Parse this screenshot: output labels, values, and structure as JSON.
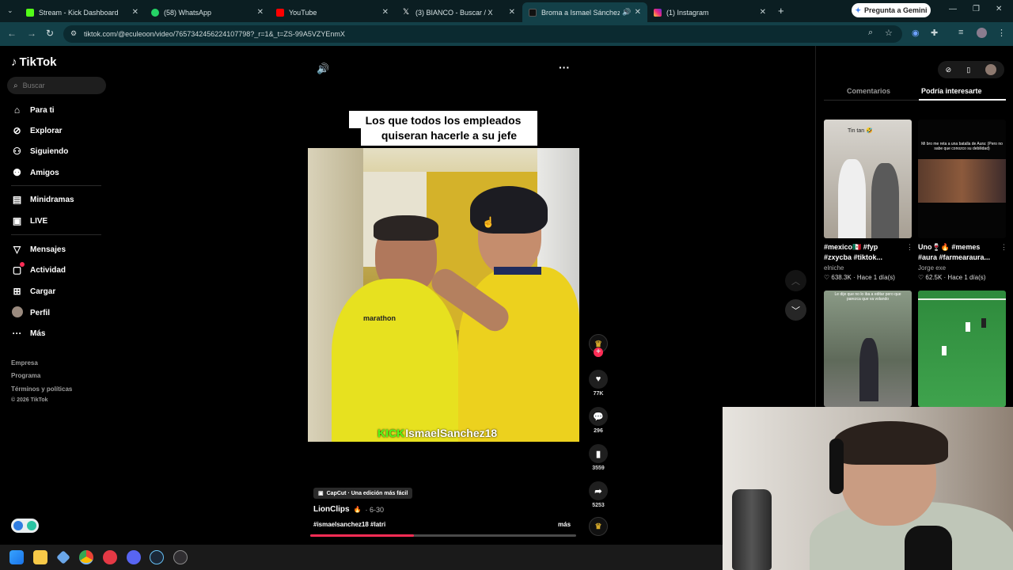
{
  "browser": {
    "tabs": [
      {
        "label": "Stream - Kick Dashboard",
        "color": "#53fc18"
      },
      {
        "label": "(58) WhatsApp",
        "color": "#25d366"
      },
      {
        "label": "YouTube",
        "color": "#ff0000"
      },
      {
        "label": "(3) BIANCO - Buscar / X",
        "color": "#ffffff"
      },
      {
        "label": "Broma a Ismael Sánchez po",
        "color": "#111111"
      },
      {
        "label": "(1) Instagram",
        "color": "#e1306c"
      }
    ],
    "new_tab_symbol": "+",
    "gemini_label": "Pregunta a Gemini",
    "url": "tiktok.com/@eculeoon/video/7657342456224107798?_r=1&_t=ZS-99A5VZYEnmX"
  },
  "sidebar": {
    "logo": "TikTok",
    "search_placeholder": "Buscar",
    "items": [
      {
        "label": "Para ti",
        "icon": "home-icon"
      },
      {
        "label": "Explorar",
        "icon": "compass-icon"
      },
      {
        "label": "Siguiendo",
        "icon": "following-icon"
      },
      {
        "label": "Amigos",
        "icon": "friends-icon"
      },
      {
        "label": "Minidramas",
        "icon": "minidramas-icon"
      },
      {
        "label": "LIVE",
        "icon": "live-icon"
      },
      {
        "label": "Mensajes",
        "icon": "messages-icon"
      },
      {
        "label": "Actividad",
        "icon": "activity-icon"
      },
      {
        "label": "Cargar",
        "icon": "upload-icon"
      },
      {
        "label": "Perfil",
        "icon": "profile-icon"
      },
      {
        "label": "Más",
        "icon": "more-icon"
      }
    ],
    "footer": [
      "Empresa",
      "Programa",
      "Términos y políticas",
      "© 2026 TikTok"
    ]
  },
  "video": {
    "caption_line1": "Los que todos los empleados",
    "caption_line2": "quiseran hacerle a su jefe",
    "overlay_text_kick": "KICK",
    "overlay_text_name": "IsmaelSanchez18",
    "capcut_label": "CapCut · Una edición más fácil",
    "author": "LionClips",
    "date": "· 6-30",
    "hashtags": "#ismaelsanchez18 #latri",
    "more_label": "más",
    "progress": 0.39
  },
  "actions": {
    "likes": "77K",
    "comments": "296",
    "saves": "3559",
    "shares": "5253",
    "avatar_label": "LIONCLIPS"
  },
  "right_panel": {
    "tab_comments": "Comentarios",
    "tab_suggested": "Podría interesarte",
    "cards": [
      {
        "thumb_text": "Tin tan 🤣",
        "title_line1": "#mexico🇲🇽 #fyp",
        "title_line2": "#zxycba #tiktok...",
        "author": "elniche",
        "likes": "638.3K",
        "time": "Hace 1 día(s)"
      },
      {
        "thumb_text": "Mi bro me reta a una batalla de Aura: (Pero no sabe que conozco su debilidad)",
        "title_line1": "Uno🍷🔥 #memes",
        "title_line2": "#aura #farmearaura...",
        "author": "Jorge exe",
        "likes": "62.5K",
        "time": "Hace 1 día(s)"
      },
      {
        "thumb_text": "Le dije que no lo iba a editar pero que parezca que va volando",
        "title_line1": "",
        "title_line2": "",
        "author": "",
        "likes": "",
        "time": ""
      },
      {
        "thumb_text": "",
        "title_line1": "",
        "title_line2": "",
        "author": "",
        "likes": "",
        "time": ""
      }
    ]
  }
}
